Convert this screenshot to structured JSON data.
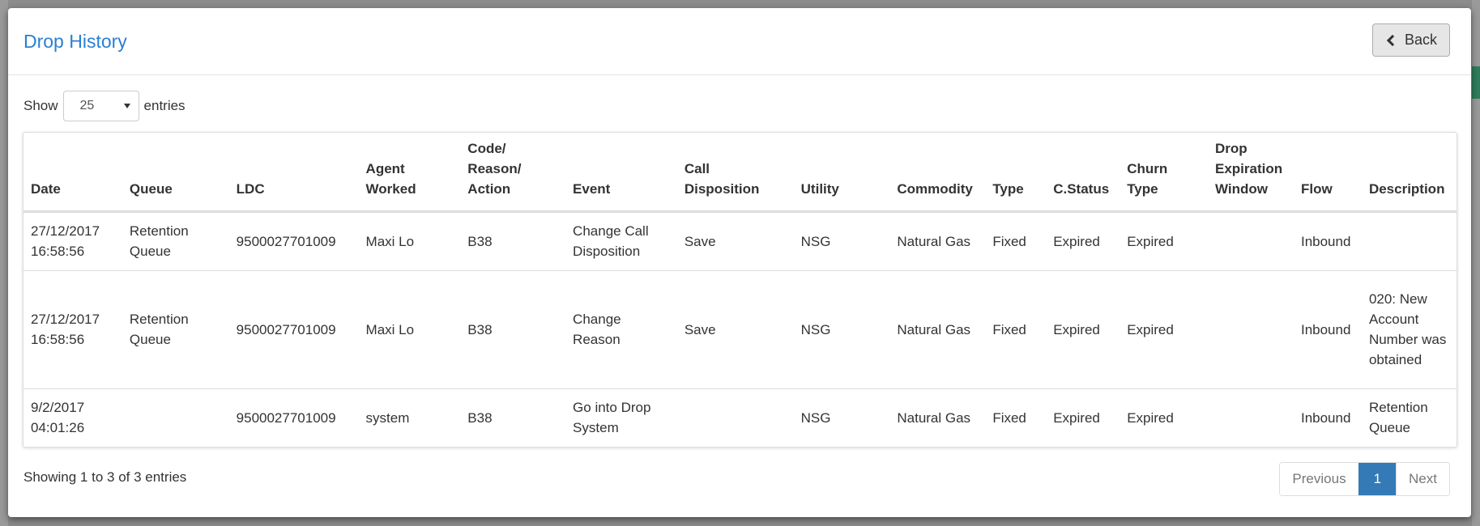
{
  "modal": {
    "title": "Drop History",
    "back_label": "Back"
  },
  "length": {
    "show_label": "Show",
    "selected": "25",
    "entries_label": "entries"
  },
  "table": {
    "headers": [
      "Date",
      "Queue",
      "LDC",
      "Agent Worked",
      "Code/ Reason/ Action",
      "Event",
      "Call Disposition",
      "Utility",
      "Commodity",
      "Type",
      "C.Status",
      "Churn Type",
      "Drop Expiration Window",
      "Flow",
      "Description"
    ],
    "rows": [
      [
        "27/12/2017 16:58:56",
        "Retention Queue",
        "9500027701009",
        "Maxi Lo",
        "B38",
        "Change Call Disposition",
        "Save",
        "NSG",
        "Natural Gas",
        "Fixed",
        "Expired",
        "Expired",
        "",
        "Inbound",
        ""
      ],
      [
        "27/12/2017 16:58:56",
        "Retention Queue",
        "9500027701009",
        "Maxi Lo",
        "B38",
        "Change Reason",
        "Save",
        "NSG",
        "Natural Gas",
        "Fixed",
        "Expired",
        "Expired",
        "",
        "Inbound",
        "020: New Account Number was obtained"
      ],
      [
        "9/2/2017 04:01:26",
        "",
        "9500027701009",
        "system",
        "B38",
        "Go into Drop System",
        "",
        "NSG",
        "Natural Gas",
        "Fixed",
        "Expired",
        "Expired",
        "",
        "Inbound",
        "Retention Queue"
      ]
    ]
  },
  "footer": {
    "info": "Showing 1 to 3 of 3 entries",
    "previous": "Previous",
    "page": "1",
    "next": "Next"
  },
  "colors": {
    "title": "#2a7fd4",
    "pager_active": "#337ab7"
  }
}
